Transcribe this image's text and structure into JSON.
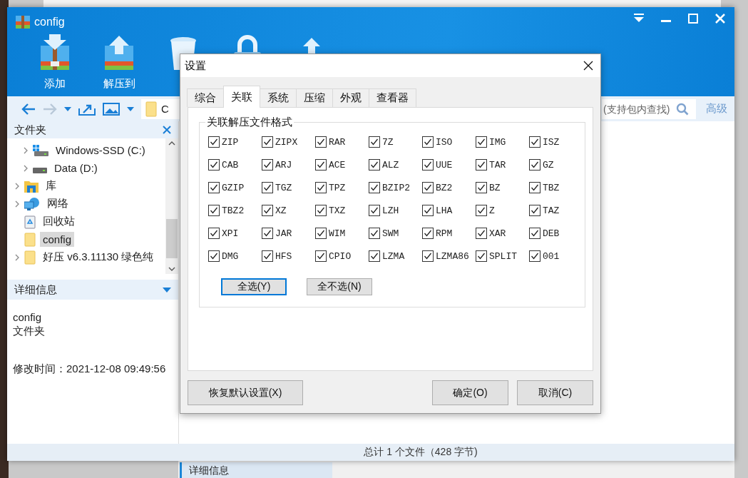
{
  "background": {
    "details_label": "详细信息"
  },
  "window": {
    "title": "config"
  },
  "toolbar": [
    {
      "kind": "add",
      "label": "添加"
    },
    {
      "kind": "extract",
      "label": "解压到"
    },
    {
      "kind": "delete"
    },
    {
      "kind": "lock"
    },
    {
      "kind": "upload"
    }
  ],
  "address_bar": {
    "path": "C"
  },
  "search": {
    "placeholder": "(支持包内查找)",
    "advanced": "高级"
  },
  "folders": {
    "title": "文件夹",
    "continued_children": [
      {
        "label": "Windows-SSD (C:)",
        "kind": "system-drive",
        "expandable": true,
        "selected": false
      },
      {
        "label": "Data (D:)",
        "kind": "drive",
        "expandable": true,
        "selected": false
      }
    ],
    "items": [
      {
        "label": "库",
        "kind": "library",
        "expandable": true,
        "selected": false
      },
      {
        "label": "网络",
        "kind": "network",
        "expandable": true,
        "selected": false
      },
      {
        "label": "回收站",
        "kind": "recycle",
        "expandable": false,
        "selected": false
      },
      {
        "label": "config",
        "kind": "folder",
        "expandable": false,
        "selected": true
      },
      {
        "label": "好压 v6.3.11130 绿色纯",
        "kind": "folder",
        "expandable": true,
        "selected": false
      }
    ]
  },
  "details": {
    "title": "详细信息",
    "name": "config",
    "type": "文件夹",
    "modified": "修改时间：2021-12-08 09:49:56"
  },
  "status_bar": "总计 1 个文件（428 字节)",
  "dialog": {
    "title": "设置",
    "tabs": [
      {
        "label": "综合",
        "selected": false
      },
      {
        "label": "关联",
        "selected": true
      },
      {
        "label": "系统",
        "selected": false
      },
      {
        "label": "压缩",
        "selected": false
      },
      {
        "label": "外观",
        "selected": false
      },
      {
        "label": "查看器",
        "selected": false
      }
    ],
    "group_title": "关联解压文件格式",
    "formats": [
      {
        "label": "ZIP",
        "checked": true
      },
      {
        "label": "ZIPX",
        "checked": true
      },
      {
        "label": "RAR",
        "checked": true
      },
      {
        "label": "7Z",
        "checked": true
      },
      {
        "label": "ISO",
        "checked": true
      },
      {
        "label": "IMG",
        "checked": true
      },
      {
        "label": "ISZ",
        "checked": true
      },
      {
        "label": "CAB",
        "checked": true
      },
      {
        "label": "ARJ",
        "checked": true
      },
      {
        "label": "ACE",
        "checked": true
      },
      {
        "label": "ALZ",
        "checked": true
      },
      {
        "label": "UUE",
        "checked": true
      },
      {
        "label": "TAR",
        "checked": true
      },
      {
        "label": "GZ",
        "checked": true
      },
      {
        "label": "GZIP",
        "checked": true
      },
      {
        "label": "TGZ",
        "checked": true
      },
      {
        "label": "TPZ",
        "checked": true
      },
      {
        "label": "BZIP2",
        "checked": true
      },
      {
        "label": "BZ2",
        "checked": true
      },
      {
        "label": "BZ",
        "checked": true
      },
      {
        "label": "TBZ",
        "checked": true
      },
      {
        "label": "TBZ2",
        "checked": true
      },
      {
        "label": "XZ",
        "checked": true
      },
      {
        "label": "TXZ",
        "checked": true
      },
      {
        "label": "LZH",
        "checked": true
      },
      {
        "label": "LHA",
        "checked": true
      },
      {
        "label": "Z",
        "checked": true
      },
      {
        "label": "TAZ",
        "checked": true
      },
      {
        "label": "XPI",
        "checked": true
      },
      {
        "label": "JAR",
        "checked": true
      },
      {
        "label": "WIM",
        "checked": true
      },
      {
        "label": "SWM",
        "checked": true
      },
      {
        "label": "RPM",
        "checked": true
      },
      {
        "label": "XAR",
        "checked": true
      },
      {
        "label": "DEB",
        "checked": true
      },
      {
        "label": "DMG",
        "checked": true
      },
      {
        "label": "HFS",
        "checked": true
      },
      {
        "label": "CPIO",
        "checked": true
      },
      {
        "label": "LZMA",
        "checked": true
      },
      {
        "label": "LZMA86",
        "checked": true
      },
      {
        "label": "SPLIT",
        "checked": true
      },
      {
        "label": "001",
        "checked": true
      }
    ],
    "group_buttons": [
      {
        "label": "全选(Y)",
        "default": true
      },
      {
        "label": "全不选(N)",
        "default": false
      }
    ],
    "footer_left": "恢复默认设置(X)",
    "footer_buttons": [
      "确定(O)",
      "取消(C)"
    ]
  }
}
